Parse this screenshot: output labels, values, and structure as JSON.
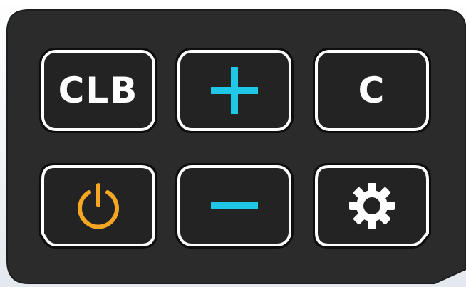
{
  "colors": {
    "panel": "#2b2b2b",
    "key_face": "#232323",
    "key_border": "#ffffff",
    "plus_minus_accent": "#1ec8e6",
    "power_accent": "#f5a623"
  },
  "keypad": {
    "keys": [
      {
        "label": "CLB",
        "icon": ""
      },
      {
        "label": "",
        "icon": "plus-icon"
      },
      {
        "label": "C",
        "icon": ""
      },
      {
        "label": "",
        "icon": "power-icon"
      },
      {
        "label": "",
        "icon": "minus-icon"
      },
      {
        "label": "",
        "icon": "gear-icon"
      }
    ]
  }
}
